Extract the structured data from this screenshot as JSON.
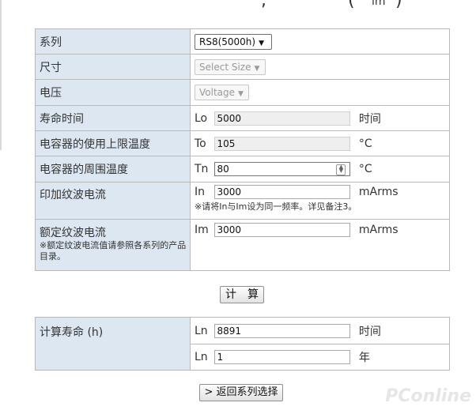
{
  "series": {
    "label": "系列",
    "selected": "RS8(5000h)"
  },
  "size": {
    "label": "尺寸",
    "placeholder": "Select Size"
  },
  "voltage": {
    "label": "电压",
    "placeholder": "Voltage"
  },
  "lifetime": {
    "label": "寿命时间",
    "prefix": "Lo",
    "value": "5000",
    "unit": "时间"
  },
  "upper_temp": {
    "label": "电容器的使用上限温度",
    "prefix": "To",
    "value": "105",
    "unit": "°C"
  },
  "ambient_temp": {
    "label": "电容器的周围温度",
    "prefix": "Tn",
    "value": "80",
    "unit": "°C"
  },
  "applied_ripple": {
    "label": "印加纹波电流",
    "prefix": "In",
    "value": "3000",
    "unit": "mArms",
    "note": "※请将In与Im设为同一频率。详见备注3。"
  },
  "rated_ripple": {
    "label": "额定纹波电流",
    "note": "※额定纹波电流值请参照各系列的产品目录。",
    "prefix": "Im",
    "value": "3000",
    "unit": "mArms"
  },
  "calc_button": "计　算",
  "result": {
    "label": "计算寿命 (h)",
    "hours_prefix": "Ln",
    "hours_value": "8891",
    "hours_unit": "时间",
    "years_prefix": "Ln",
    "years_value": "1",
    "years_unit": "年"
  },
  "back_button": "> 返回系列选择",
  "header_fragments": {
    "comma": ",",
    "open_paren": "(",
    "subscript": "lm",
    "close_paren": ")"
  },
  "watermark": "PConline"
}
